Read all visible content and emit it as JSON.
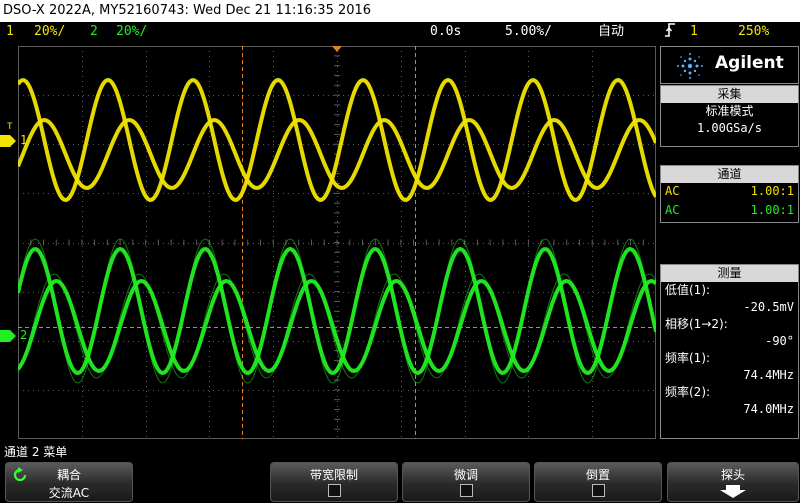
{
  "title": "DSO-X 2022A, MY52160743: Wed Dec 21 11:16:35 2016",
  "status": {
    "ch1_num": "1",
    "ch1_scale": "20%/",
    "ch2_num": "2",
    "ch2_scale": "20%/",
    "time_delay": "0.0s",
    "time_scale": "5.00%/",
    "trigger_mode": "自动",
    "trigger_icon": "rising-edge-icon",
    "trigger_ch": "1",
    "trigger_level": "250%"
  },
  "markers": {
    "ch1_label": "1",
    "ch2_label": "2",
    "trig_label": "T"
  },
  "panel": {
    "brand": "Agilent",
    "acquire_title": "采集",
    "acquire_mode": "标准模式",
    "acquire_rate": "1.00GSa/s",
    "channels_title": "通道",
    "channels": [
      {
        "coupling": "AC",
        "ratio": "1.00:1"
      },
      {
        "coupling": "AC",
        "ratio": "1.00:1"
      }
    ],
    "measure_title": "测量",
    "measurements": [
      {
        "label": "低值(1):",
        "value": "-20.5mV"
      },
      {
        "label": "相移(1→2):",
        "value": "-90°"
      },
      {
        "label": "频率(1):",
        "value": "74.4MHz"
      },
      {
        "label": "频率(2):",
        "value": "74.0MHz"
      }
    ]
  },
  "menu": {
    "title": "通道 2 菜单",
    "softkeys": [
      {
        "label": "耦合",
        "value": "交流AC"
      },
      {
        "label": "带宽限制"
      },
      {
        "label": "微调"
      },
      {
        "label": "倒置"
      },
      {
        "label": "探头"
      }
    ]
  },
  "colors": {
    "ch1": "#f2e500",
    "ch2": "#22ee22",
    "grid": "#5a5a5a",
    "cursor": "#e08020"
  }
}
